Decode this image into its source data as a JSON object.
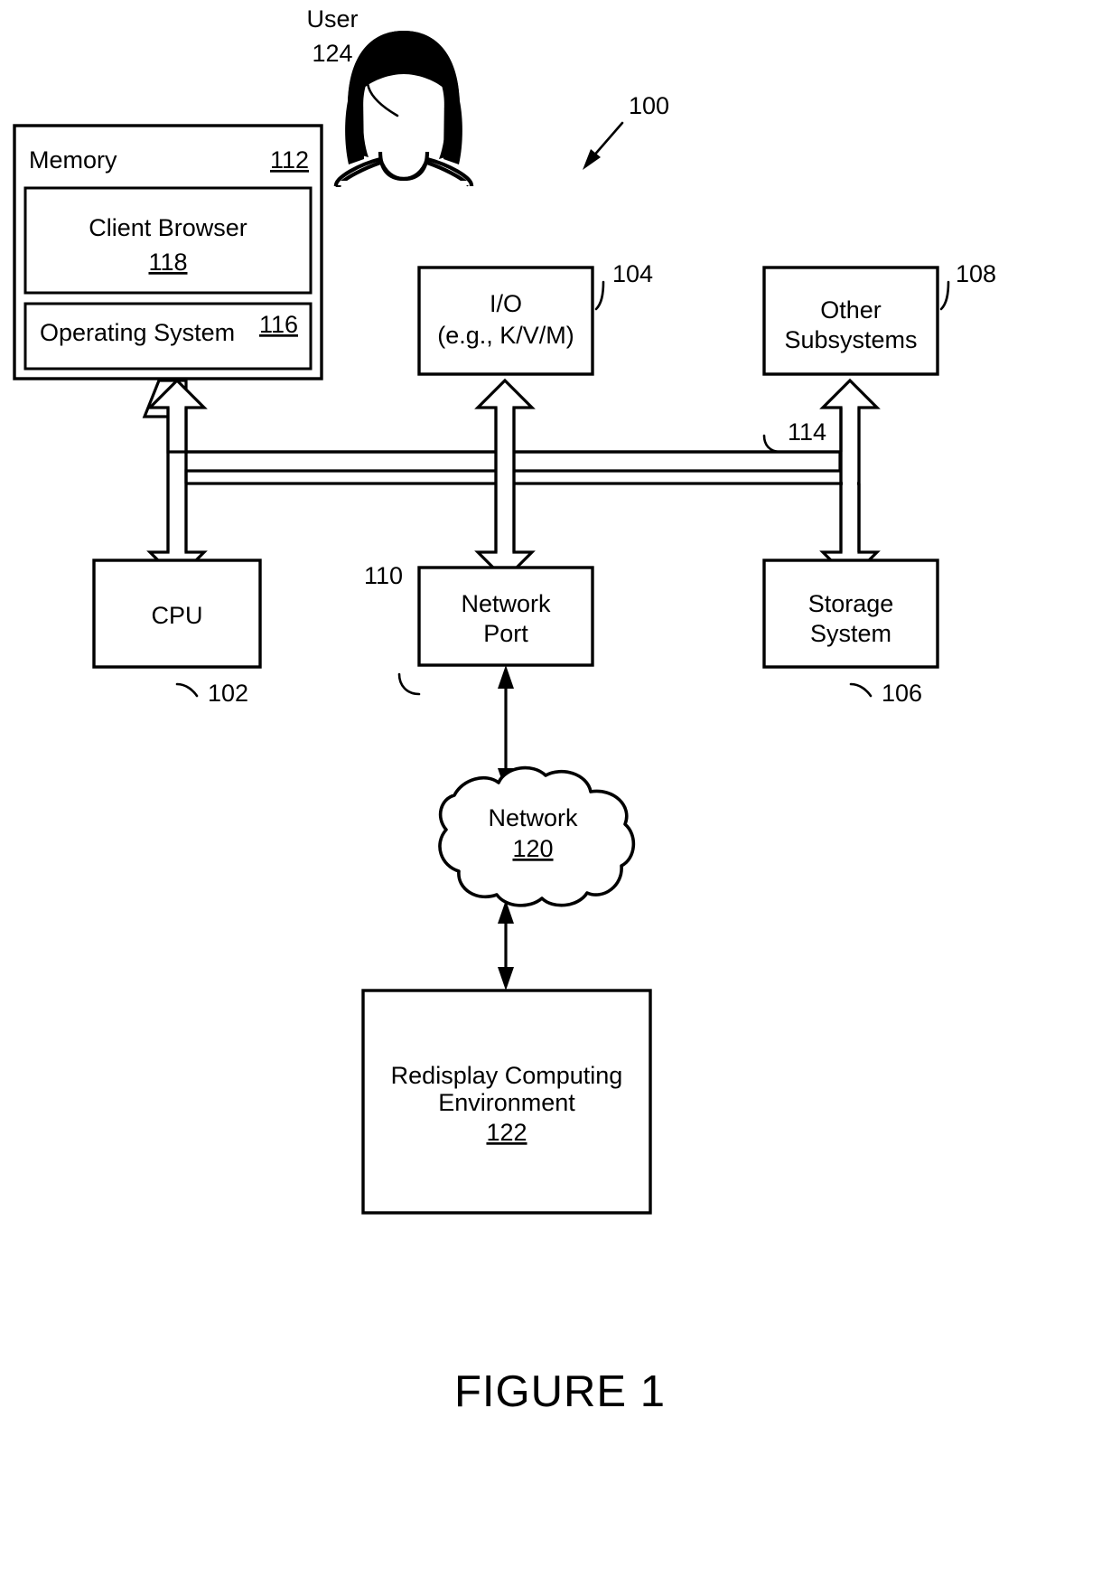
{
  "figure": {
    "caption": "FIGURE 1",
    "system_ref": "100"
  },
  "actor": {
    "label": "User",
    "ref": "124",
    "icon": "user-avatar-icon"
  },
  "blocks": {
    "memory": {
      "label": "Memory",
      "ref": "112",
      "children": [
        {
          "label": "Client Browser",
          "ref": "118"
        },
        {
          "label": "Operating System",
          "ref": "116"
        }
      ]
    },
    "io": {
      "label_line1": "I/O",
      "label_line2": "(e.g., K/V/M)",
      "ref": "104"
    },
    "other_subsystems": {
      "label_line1": "Other",
      "label_line2": "Subsystems",
      "ref": "108"
    },
    "cpu": {
      "label": "CPU",
      "ref": "102"
    },
    "network_port": {
      "label_line1": "Network",
      "label_line2": "Port",
      "ref": "110"
    },
    "storage_system": {
      "label_line1": "Storage",
      "label_line2": "System",
      "ref": "106"
    },
    "network_cloud": {
      "label": "Network",
      "ref": "120"
    },
    "redisplay": {
      "label_line1": "Redisplay Computing",
      "label_line2": "Environment",
      "ref": "122"
    }
  },
  "bus": {
    "ref": "114",
    "name": "system-bus"
  },
  "colors": {
    "stroke": "#000000",
    "fill": "#ffffff"
  }
}
